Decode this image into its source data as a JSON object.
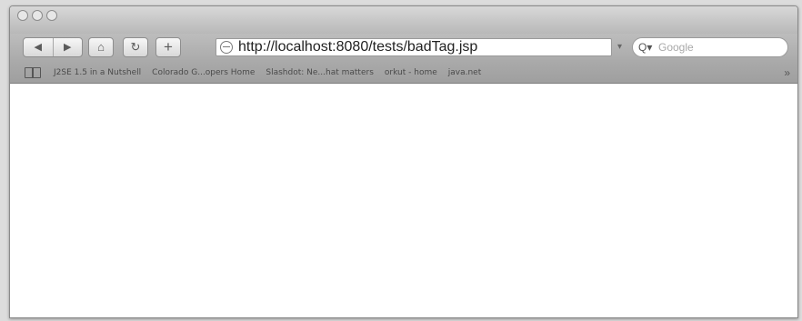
{
  "toolbar": {
    "back_glyph": "◀",
    "forward_glyph": "▶",
    "home_glyph": "⌂",
    "reload_glyph": "↻",
    "add_glyph": "+"
  },
  "address_bar": {
    "url": "http://localhost:8080/tests/badTag.jsp",
    "icon": "globe-icon"
  },
  "search": {
    "placeholder": "Google",
    "icon": "search-icon"
  },
  "bookmarks_bar": {
    "items": [
      "J2SE 1.5 in a Nutshell",
      "Colorado G...opers Home",
      "Slashdot: Ne...hat matters",
      "orkut - home",
      "java.net"
    ],
    "more_glyph": "»"
  }
}
